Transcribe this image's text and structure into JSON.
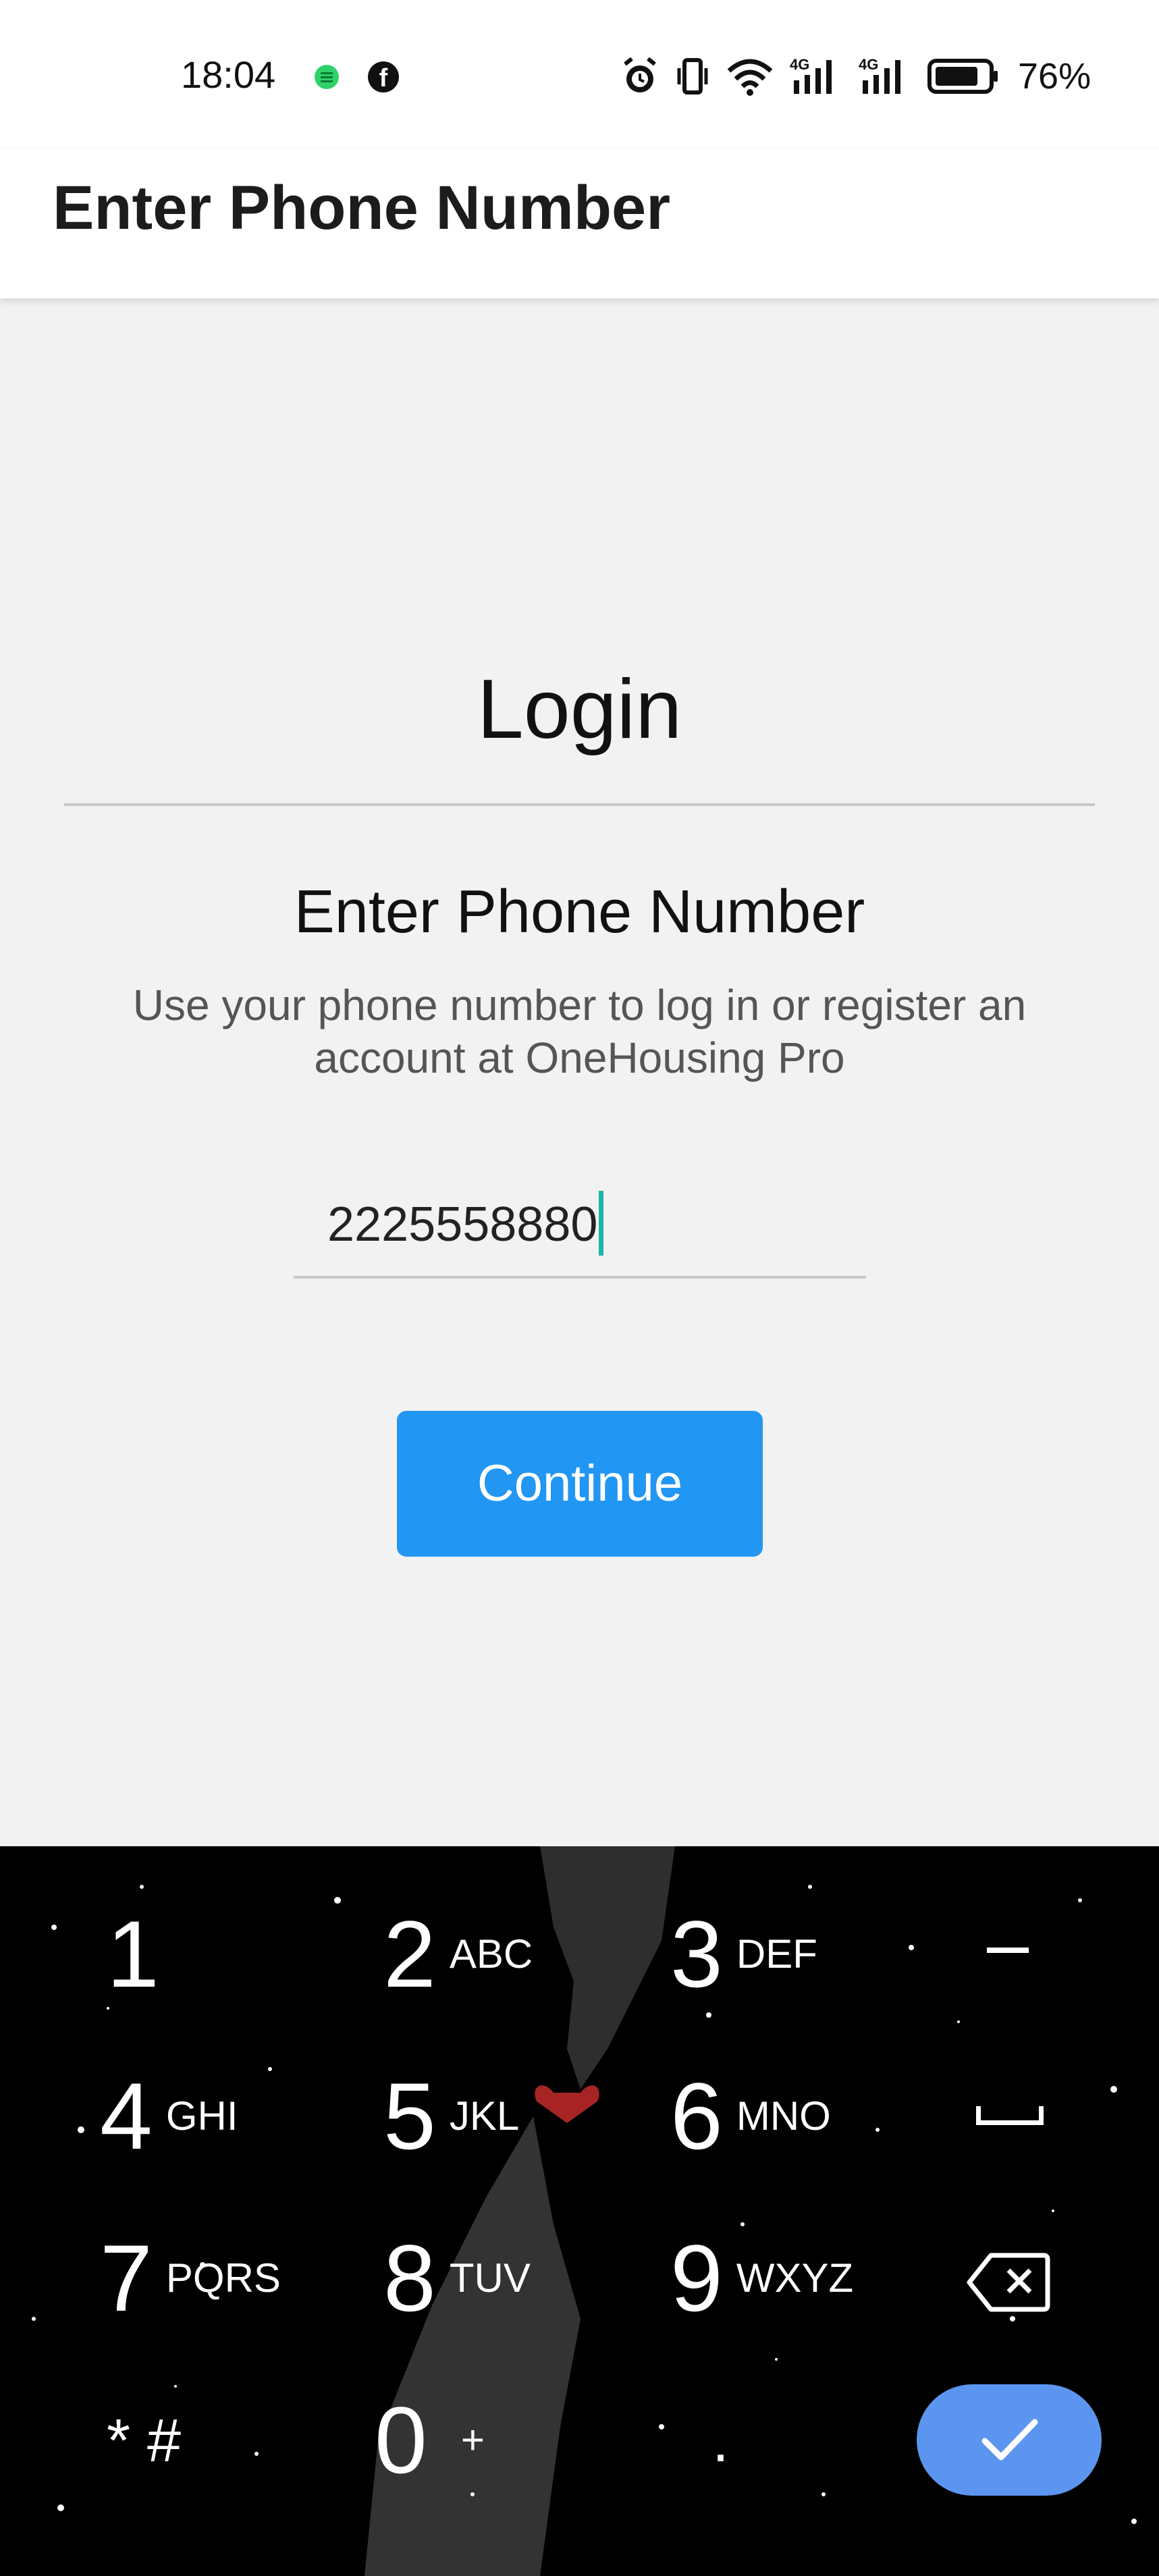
{
  "status_bar": {
    "time": "18:04",
    "battery_percent": "76%",
    "icons": [
      "spotify-icon",
      "facebook-icon",
      "alarm-icon",
      "vibrate-icon",
      "wifi-icon",
      "signal-4g-icon",
      "signal-4g-icon",
      "battery-icon"
    ]
  },
  "app_bar": {
    "title": "Enter Phone Number"
  },
  "login": {
    "heading": "Login",
    "subheading": "Enter Phone Number",
    "description": "Use your phone number to log in or register an account at OneHousing Pro",
    "phone_value": "2225558880",
    "continue_label": "Continue"
  },
  "keyboard": {
    "keys": [
      {
        "num": "1",
        "letters": ""
      },
      {
        "num": "2",
        "letters": "ABC"
      },
      {
        "num": "3",
        "letters": "DEF"
      },
      {
        "num": "4",
        "letters": "GHI"
      },
      {
        "num": "5",
        "letters": "JKL"
      },
      {
        "num": "6",
        "letters": "MNO"
      },
      {
        "num": "7",
        "letters": "PQRS"
      },
      {
        "num": "8",
        "letters": "TUV"
      },
      {
        "num": "9",
        "letters": "WXYZ"
      },
      {
        "num": "* #",
        "letters": ""
      },
      {
        "num": "0",
        "letters": "+"
      },
      {
        "num": ".",
        "letters": ""
      }
    ]
  },
  "colors": {
    "accent": "#2196f3",
    "confirm": "#5b95f0",
    "cursor": "#1bb7a6",
    "background": "#f2f2f2"
  }
}
